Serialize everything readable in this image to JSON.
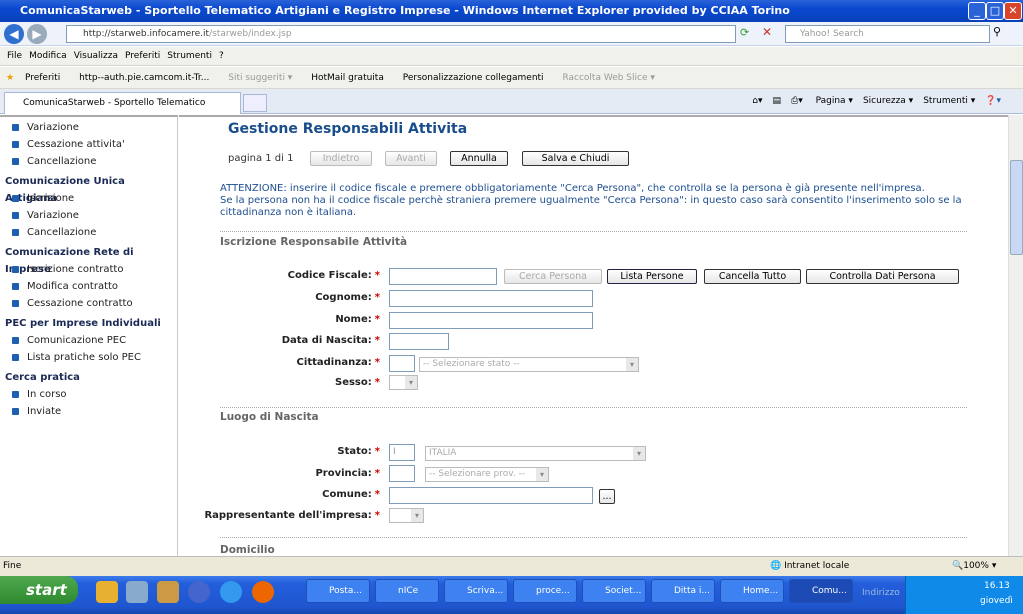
{
  "window": {
    "title": "ComunicaStarweb - Sportello Telematico Artigiani e Registro Imprese - Windows Internet Explorer provided by CCIAA Torino"
  },
  "address": {
    "host": "http://starweb.infocamere.it",
    "path": "/starweb/index.jsp",
    "search_placeholder": "Yahoo! Search"
  },
  "menu": [
    "File",
    "Modifica",
    "Visualizza",
    "Preferiti",
    "Strumenti",
    "?"
  ],
  "favorites": [
    "Preferiti",
    "http--auth.pie.camcom.it-Tr...",
    "Siti suggeriti ▾",
    "HotMail gratuita",
    "Personalizzazione collegamenti",
    "Raccolta Web Slice ▾"
  ],
  "tab": {
    "label": "ComunicaStarweb - Sportello Telematico Artigiani e Re..."
  },
  "commands": [
    "Pagina ▾",
    "Sicurezza ▾",
    "Strumenti ▾"
  ],
  "sidebar": {
    "groups": [
      {
        "title": "",
        "items": [
          "Variazione",
          "Cessazione attivita'",
          "Cancellazione"
        ]
      },
      {
        "title": "Comunicazione Unica Artigiana",
        "items": [
          "Iscrizione",
          "Variazione",
          "Cancellazione"
        ]
      },
      {
        "title": "Comunicazione Rete di Imprese",
        "items": [
          "Iscrizione contratto",
          "Modifica contratto",
          "Cessazione contratto"
        ]
      },
      {
        "title": "PEC per Imprese Individuali",
        "items": [
          "Comunicazione PEC",
          "Lista pratiche solo PEC"
        ]
      },
      {
        "title": "Cerca pratica",
        "items": [
          "In corso",
          "Inviate"
        ]
      }
    ]
  },
  "main": {
    "title": "Gestione Responsabili Attivita",
    "page_info": "pagina 1 di 1",
    "buttons": {
      "back": "Indietro",
      "next": "Avanti",
      "cancel": "Annulla",
      "save": "Salva e Chiudi",
      "search_person": "Cerca Persona",
      "list_persons": "Lista Persone",
      "clear_all": "Cancella Tutto",
      "check_data": "Controlla Dati Persona",
      "browse": "..."
    },
    "warning": "ATTENZIONE: inserire il codice fiscale e premere obbligatoriamente \"Cerca Persona\", che controlla se la persona è già presente nell'impresa.\nSe la persona non ha il codice fiscale perchè straniera premere ugualmente \"Cerca Persona\": in questo caso sarà consentito l'inserimento solo se la cittadinanza non è italiana.",
    "section1": "Iscrizione Responsabile Attività",
    "section2": "Luogo di Nascita",
    "section3": "Domicilio",
    "labels": {
      "cf": "Codice Fiscale:",
      "cognome": "Cognome:",
      "nome": "Nome:",
      "nascita": "Data di Nascita:",
      "citt": "Cittadinanza:",
      "sesso": "Sesso:",
      "stato": "Stato:",
      "provincia": "Provincia:",
      "comune": "Comune:",
      "rappr": "Rappresentante dell'impresa:"
    },
    "required_mark": "*",
    "values": {
      "citt_select": "-- Selezionare stato --",
      "stato_code": "I",
      "stato_select": "ITALIA",
      "prov_select": "-- Selezionare prov. --"
    }
  },
  "status": {
    "text": "Fine",
    "zone": "Intranet locale",
    "zoom": "100%"
  },
  "taskbar": {
    "start": "start",
    "items": [
      "Posta...",
      "nICe",
      "Scriva...",
      "proce...",
      "Societ...",
      "Ditta i...",
      "Home...",
      "Comu..."
    ],
    "address_label": "Indirizzo",
    "time": "16.13",
    "day": "giovedì"
  }
}
